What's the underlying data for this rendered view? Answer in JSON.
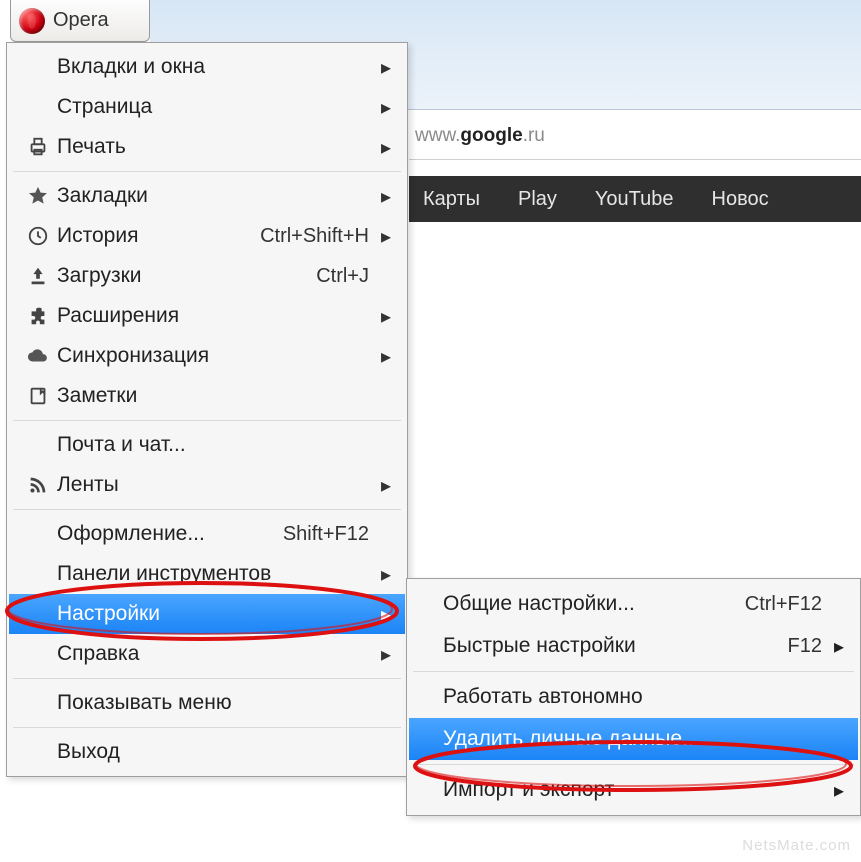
{
  "app": {
    "button_label": "Opera"
  },
  "address": {
    "prefix": "www.",
    "domain": "google",
    "suffix": ".ru"
  },
  "navbar": {
    "items": [
      "Карты",
      "Play",
      "YouTube",
      "Новос"
    ]
  },
  "menu": [
    {
      "icon": "",
      "label": "Вкладки и окна",
      "shortcut": "",
      "submenu": true
    },
    {
      "icon": "",
      "label": "Страница",
      "shortcut": "",
      "submenu": true
    },
    {
      "icon": "print",
      "label": "Печать",
      "shortcut": "",
      "submenu": true
    },
    {
      "sep": true
    },
    {
      "icon": "star",
      "label": "Закладки",
      "shortcut": "",
      "submenu": true
    },
    {
      "icon": "clock",
      "label": "История",
      "shortcut": "Ctrl+Shift+H",
      "submenu": true
    },
    {
      "icon": "download",
      "label": "Загрузки",
      "shortcut": "Ctrl+J",
      "submenu": false
    },
    {
      "icon": "puzzle",
      "label": "Расширения",
      "shortcut": "",
      "submenu": true
    },
    {
      "icon": "cloud",
      "label": "Синхронизация",
      "shortcut": "",
      "submenu": true
    },
    {
      "icon": "note",
      "label": "Заметки",
      "shortcut": "",
      "submenu": false
    },
    {
      "sep": true
    },
    {
      "icon": "",
      "label": "Почта и чат...",
      "shortcut": "",
      "submenu": false
    },
    {
      "icon": "rss",
      "label": "Ленты",
      "shortcut": "",
      "submenu": true
    },
    {
      "sep": true
    },
    {
      "icon": "",
      "label": "Оформление...",
      "shortcut": "Shift+F12",
      "submenu": false
    },
    {
      "icon": "",
      "label": "Панели инструментов",
      "shortcut": "",
      "submenu": true
    },
    {
      "icon": "",
      "label": "Настройки",
      "shortcut": "",
      "submenu": true,
      "highlight": true
    },
    {
      "icon": "",
      "label": "Справка",
      "shortcut": "",
      "submenu": true
    },
    {
      "sep": true
    },
    {
      "icon": "",
      "label": "Показывать меню",
      "shortcut": "",
      "submenu": false
    },
    {
      "sep": true
    },
    {
      "icon": "",
      "label": "Выход",
      "shortcut": "",
      "submenu": false
    }
  ],
  "submenu": [
    {
      "label": "Общие настройки...",
      "shortcut": "Ctrl+F12",
      "submenu": false
    },
    {
      "label": "Быстрые настройки",
      "shortcut": "F12",
      "submenu": true
    },
    {
      "sep": true
    },
    {
      "label": "Работать автономно",
      "shortcut": "",
      "submenu": false
    },
    {
      "label": "Удалить личные данные...",
      "shortcut": "",
      "submenu": false,
      "highlight": true
    },
    {
      "sep": true
    },
    {
      "label": "Импорт и экспорт",
      "shortcut": "",
      "submenu": true
    }
  ],
  "watermark": "NetsMate.com"
}
